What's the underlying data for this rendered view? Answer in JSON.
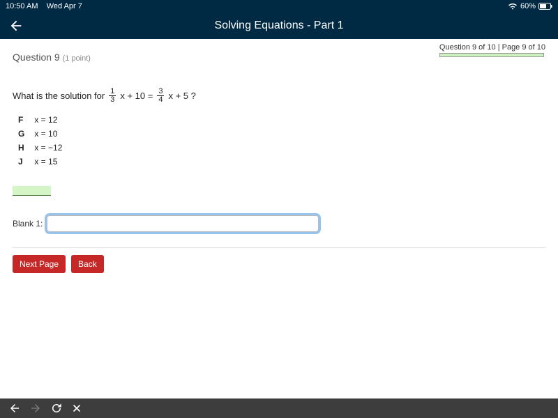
{
  "status": {
    "time": "10:50 AM",
    "date": "Wed Apr 7",
    "battery_pct": "60%"
  },
  "header": {
    "title": "Solving Equations - Part 1"
  },
  "meta": {
    "line": "Question 9 of 10 | Page 9 of 10"
  },
  "question": {
    "number": "Question 9",
    "points": "(1 point)",
    "prompt_prefix": "What is the solution for",
    "frac1_num": "1",
    "frac1_den": "3",
    "mid1": "x + 10 =",
    "frac2_num": "3",
    "frac2_den": "4",
    "tail": "x + 5 ?"
  },
  "choices": [
    {
      "label": "F",
      "text": "x = 12"
    },
    {
      "label": "G",
      "text": "x = 10"
    },
    {
      "label": "H",
      "text": "x = −12"
    },
    {
      "label": "J",
      "text": "x = 15"
    }
  ],
  "blank": {
    "label": "Blank 1:",
    "value": ""
  },
  "buttons": {
    "next": "Next Page",
    "back": "Back"
  }
}
